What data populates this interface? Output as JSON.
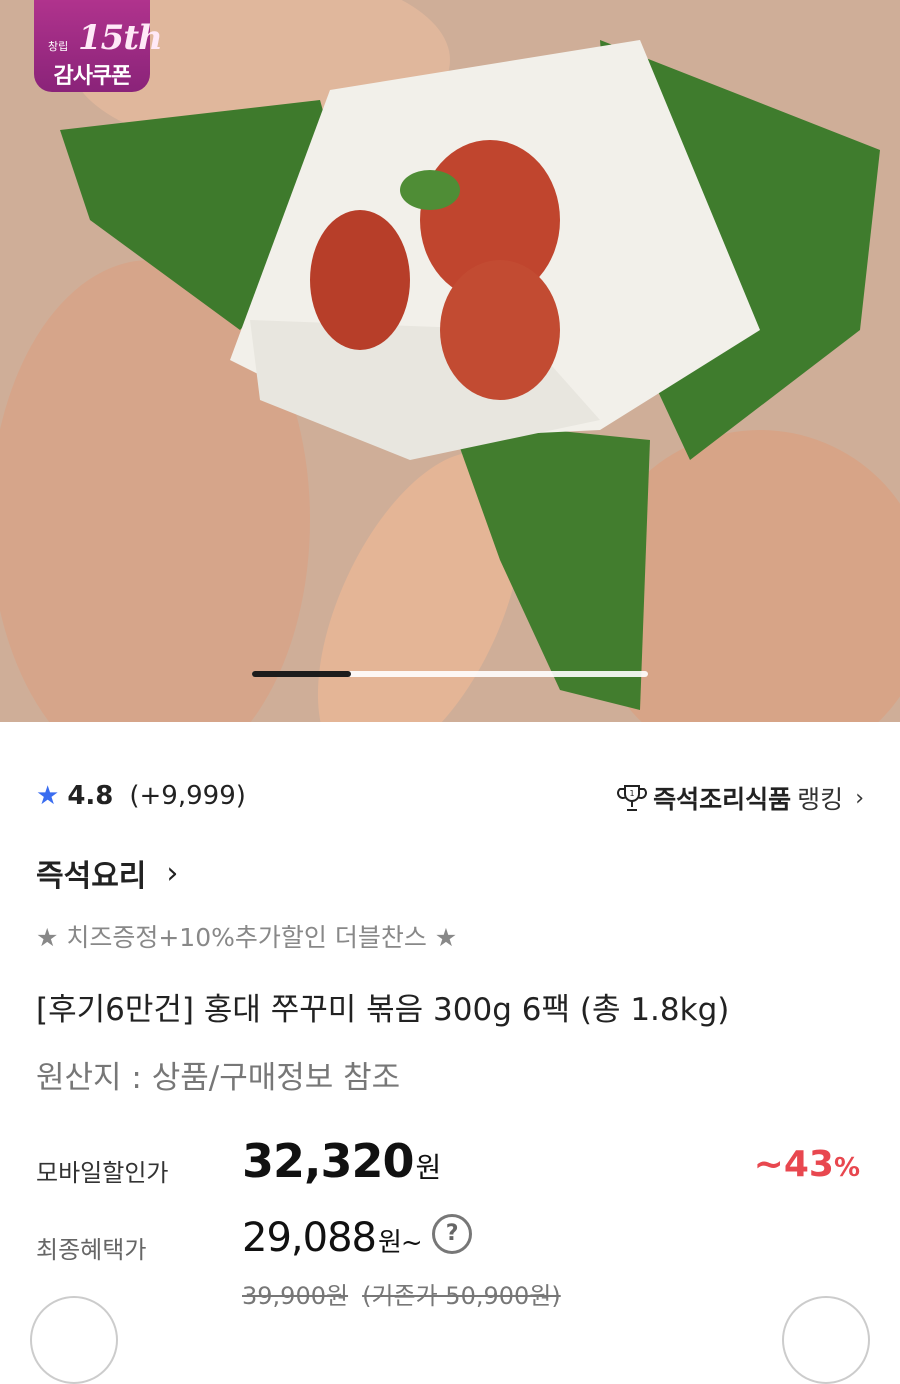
{
  "hero": {
    "badge": {
      "small": "창립",
      "number": "15th",
      "label": "감사쿠폰"
    },
    "slider_progress": 0.25
  },
  "rating": {
    "star_icon": "star-icon",
    "score": "4.8",
    "count": "(+9,999)"
  },
  "ranking": {
    "trophy_icon": "trophy-icon",
    "category": "즉석조리식품",
    "label": "랭킹",
    "chevron": "›"
  },
  "brand": {
    "name": "즉석요리",
    "chevron": "›"
  },
  "promo_text": "★ 치즈증정+10%추가할인 더블찬스 ★",
  "product_title": "[후기6만건] 홍대 쭈꾸미 볶음 300g 6팩 (총 1.8kg)",
  "origin": "원산지 : 상품/구매정보 참조",
  "pricing": {
    "mobile_label": "모바일할인가",
    "mobile_price": "32,320",
    "currency": "원",
    "discount": "~43",
    "discount_pct": "%",
    "final_label": "최종혜택가",
    "final_price": "29,088",
    "final_suffix": "원~",
    "help": "?",
    "original_price": "39,900원",
    "previous_price": "(기존가 50,900원)"
  },
  "colors": {
    "accent_blue": "#3a6df0",
    "discount_red": "#e8474f",
    "badge_purple": "#9c2b85"
  }
}
